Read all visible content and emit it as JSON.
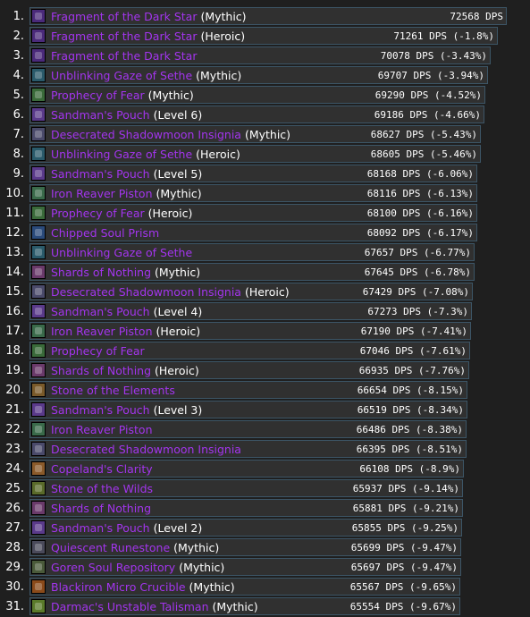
{
  "colors": {
    "item_name": "#a335ee",
    "qualifier": "#ffffff",
    "background": "#1f1f1f",
    "bar_fill": "#303030",
    "bar_border": "#3c5566"
  },
  "rows": [
    {
      "rank": "1.",
      "name": "Fragment of the Dark Star",
      "qualifier": "(Mythic)",
      "dps": "72568 DPS",
      "icon": "dark-star-fragment-icon",
      "icon_color": "#4a2a7a",
      "fraction": 1.0
    },
    {
      "rank": "2.",
      "name": "Fragment of the Dark Star",
      "qualifier": "(Heroic)",
      "dps": "71261 DPS (-1.8%)",
      "icon": "dark-star-fragment-icon",
      "icon_color": "#4a2a7a",
      "fraction": 0.982
    },
    {
      "rank": "3.",
      "name": "Fragment of the Dark Star",
      "qualifier": "",
      "dps": "70078 DPS (-3.43%)",
      "icon": "dark-star-fragment-icon",
      "icon_color": "#4a2a7a",
      "fraction": 0.966
    },
    {
      "rank": "4.",
      "name": "Unblinking Gaze of Sethe",
      "qualifier": "(Mythic)",
      "dps": "69707 DPS (-3.94%)",
      "icon": "sethe-gaze-icon",
      "icon_color": "#2a5a6a",
      "fraction": 0.961
    },
    {
      "rank": "5.",
      "name": "Prophecy of Fear",
      "qualifier": "(Mythic)",
      "dps": "69290 DPS (-4.52%)",
      "icon": "prophecy-icon",
      "icon_color": "#3a6a3a",
      "fraction": 0.955
    },
    {
      "rank": "6.",
      "name": "Sandman's Pouch",
      "qualifier": "(Level 6)",
      "dps": "69186 DPS (-4.66%)",
      "icon": "pouch-icon",
      "icon_color": "#5a3a8a",
      "fraction": 0.953
    },
    {
      "rank": "7.",
      "name": "Desecrated Shadowmoon Insignia",
      "qualifier": "(Mythic)",
      "dps": "68627 DPS (-5.43%)",
      "icon": "insignia-icon",
      "icon_color": "#4a4a6a",
      "fraction": 0.946
    },
    {
      "rank": "8.",
      "name": "Unblinking Gaze of Sethe",
      "qualifier": "(Heroic)",
      "dps": "68605 DPS (-5.46%)",
      "icon": "sethe-gaze-icon",
      "icon_color": "#2a5a6a",
      "fraction": 0.945
    },
    {
      "rank": "9.",
      "name": "Sandman's Pouch",
      "qualifier": "(Level 5)",
      "dps": "68168 DPS (-6.06%)",
      "icon": "pouch-icon",
      "icon_color": "#5a3a8a",
      "fraction": 0.939
    },
    {
      "rank": "10.",
      "name": "Iron Reaver Piston",
      "qualifier": "(Mythic)",
      "dps": "68116 DPS (-6.13%)",
      "icon": "piston-icon",
      "icon_color": "#3a6a4a",
      "fraction": 0.939
    },
    {
      "rank": "11.",
      "name": "Prophecy of Fear",
      "qualifier": "(Heroic)",
      "dps": "68100 DPS (-6.16%)",
      "icon": "prophecy-icon",
      "icon_color": "#3a6a3a",
      "fraction": 0.938
    },
    {
      "rank": "12.",
      "name": "Chipped Soul Prism",
      "qualifier": "",
      "dps": "68092 DPS (-6.17%)",
      "icon": "soul-prism-icon",
      "icon_color": "#2a4a7a",
      "fraction": 0.938
    },
    {
      "rank": "13.",
      "name": "Unblinking Gaze of Sethe",
      "qualifier": "",
      "dps": "67657 DPS (-6.77%)",
      "icon": "sethe-gaze-icon",
      "icon_color": "#2a5a6a",
      "fraction": 0.932
    },
    {
      "rank": "14.",
      "name": "Shards of Nothing",
      "qualifier": "(Mythic)",
      "dps": "67645 DPS (-6.78%)",
      "icon": "shards-icon",
      "icon_color": "#6a3a6a",
      "fraction": 0.932
    },
    {
      "rank": "15.",
      "name": "Desecrated Shadowmoon Insignia",
      "qualifier": "(Heroic)",
      "dps": "67429 DPS (-7.08%)",
      "icon": "insignia-icon",
      "icon_color": "#4a4a6a",
      "fraction": 0.929
    },
    {
      "rank": "16.",
      "name": "Sandman's Pouch",
      "qualifier": "(Level 4)",
      "dps": "67273 DPS (-7.3%)",
      "icon": "pouch-icon",
      "icon_color": "#5a3a8a",
      "fraction": 0.927
    },
    {
      "rank": "17.",
      "name": "Iron Reaver Piston",
      "qualifier": "(Heroic)",
      "dps": "67190 DPS (-7.41%)",
      "icon": "piston-icon",
      "icon_color": "#3a6a4a",
      "fraction": 0.926
    },
    {
      "rank": "18.",
      "name": "Prophecy of Fear",
      "qualifier": "",
      "dps": "67046 DPS (-7.61%)",
      "icon": "prophecy-icon",
      "icon_color": "#3a6a3a",
      "fraction": 0.924
    },
    {
      "rank": "19.",
      "name": "Shards of Nothing",
      "qualifier": "(Heroic)",
      "dps": "66935 DPS (-7.76%)",
      "icon": "shards-icon",
      "icon_color": "#6a3a6a",
      "fraction": 0.922
    },
    {
      "rank": "20.",
      "name": "Stone of the Elements",
      "qualifier": "",
      "dps": "66654 DPS (-8.15%)",
      "icon": "elements-stone-icon",
      "icon_color": "#7a5a2a",
      "fraction": 0.918
    },
    {
      "rank": "21.",
      "name": "Sandman's Pouch",
      "qualifier": "(Level 3)",
      "dps": "66519 DPS (-8.34%)",
      "icon": "pouch-icon",
      "icon_color": "#5a3a8a",
      "fraction": 0.917
    },
    {
      "rank": "22.",
      "name": "Iron Reaver Piston",
      "qualifier": "",
      "dps": "66486 DPS (-8.38%)",
      "icon": "piston-icon",
      "icon_color": "#3a6a4a",
      "fraction": 0.916
    },
    {
      "rank": "23.",
      "name": "Desecrated Shadowmoon Insignia",
      "qualifier": "",
      "dps": "66395 DPS (-8.51%)",
      "icon": "insignia-icon",
      "icon_color": "#4a4a6a",
      "fraction": 0.915
    },
    {
      "rank": "24.",
      "name": "Copeland's Clarity",
      "qualifier": "",
      "dps": "66108 DPS (-8.9%)",
      "icon": "clarity-icon",
      "icon_color": "#8a5a2a",
      "fraction": 0.911
    },
    {
      "rank": "25.",
      "name": "Stone of the Wilds",
      "qualifier": "",
      "dps": "65937 DPS (-9.14%)",
      "icon": "wilds-stone-icon",
      "icon_color": "#5a6a2a",
      "fraction": 0.909
    },
    {
      "rank": "26.",
      "name": "Shards of Nothing",
      "qualifier": "",
      "dps": "65881 DPS (-9.21%)",
      "icon": "shards-icon",
      "icon_color": "#6a3a6a",
      "fraction": 0.908
    },
    {
      "rank": "27.",
      "name": "Sandman's Pouch",
      "qualifier": "(Level 2)",
      "dps": "65855 DPS (-9.25%)",
      "icon": "pouch-icon",
      "icon_color": "#5a3a8a",
      "fraction": 0.907
    },
    {
      "rank": "28.",
      "name": "Quiescent Runestone",
      "qualifier": "(Mythic)",
      "dps": "65699 DPS (-9.47%)",
      "icon": "runestone-icon",
      "icon_color": "#4a4a5a",
      "fraction": 0.905
    },
    {
      "rank": "29.",
      "name": "Goren Soul Repository",
      "qualifier": "(Mythic)",
      "dps": "65697 DPS (-9.47%)",
      "icon": "soul-repository-icon",
      "icon_color": "#4a5a3a",
      "fraction": 0.905
    },
    {
      "rank": "30.",
      "name": "Blackiron Micro Crucible",
      "qualifier": "(Mythic)",
      "dps": "65567 DPS (-9.65%)",
      "icon": "crucible-icon",
      "icon_color": "#8a4a1a",
      "fraction": 0.903
    },
    {
      "rank": "31.",
      "name": "Darmac's Unstable Talisman",
      "qualifier": "(Mythic)",
      "dps": "65554 DPS (-9.67%)",
      "icon": "talisman-icon",
      "icon_color": "#5a7a2a",
      "fraction": 0.903
    }
  ]
}
